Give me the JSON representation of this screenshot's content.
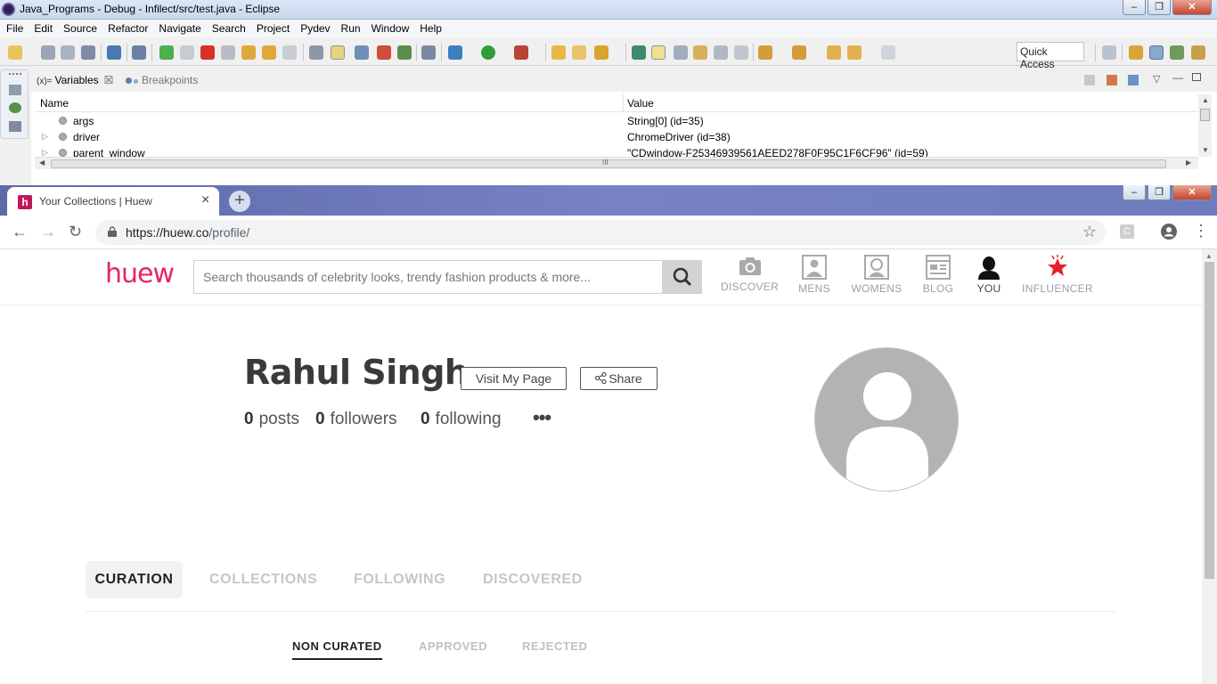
{
  "eclipse": {
    "window_title": "Java_Programs - Debug - Infilect/src/test.java - Eclipse",
    "menu": [
      "File",
      "Edit",
      "Source",
      "Refactor",
      "Navigate",
      "Search",
      "Project",
      "Pydev",
      "Run",
      "Window",
      "Help"
    ],
    "quick_access": "Quick Access",
    "views": {
      "variables_tab": "Variables",
      "variables_prefix": "(x)=",
      "breakpoints_tab": "Breakpoints"
    },
    "variables": {
      "columns": [
        "Name",
        "Value"
      ],
      "rows": [
        {
          "name": "args",
          "value": "String[0]  (id=35)"
        },
        {
          "name": "driver",
          "value": "ChromeDriver  (id=38)"
        },
        {
          "name": "parent_window",
          "value": "\"CDwindow-F25346939561AEED278F0F95C1F6CF96\" (id=59)"
        }
      ]
    },
    "scroll_marker": "III"
  },
  "chrome": {
    "tab_title": "Your Collections | Huew",
    "favicon_letter": "h",
    "url_host": "https://huew.co",
    "url_path": "/profile/",
    "extension_letter": "C"
  },
  "huew": {
    "logo": "huew",
    "search_placeholder": "Search thousands of celebrity looks, trendy fashion products & more...",
    "nav": [
      "DISCOVER",
      "MENS",
      "WOMENS",
      "BLOG",
      "YOU",
      "INFLUENCER"
    ],
    "profile": {
      "name": "Rahul Singh",
      "visit_label": "Visit My Page",
      "share_label": "Share",
      "posts_count": "0",
      "posts_label": "posts",
      "followers_count": "0",
      "followers_label": "followers",
      "following_count": "0",
      "following_label": "following",
      "more": "•••"
    },
    "tabs": [
      "CURATION",
      "COLLECTIONS",
      "FOLLOWING",
      "DISCOVERED"
    ],
    "subtabs": [
      "NON CURATED",
      "APPROVED",
      "REJECTED"
    ]
  },
  "colors": {
    "brand_pink": "#e3256b",
    "influencer_red": "#e8202a"
  }
}
